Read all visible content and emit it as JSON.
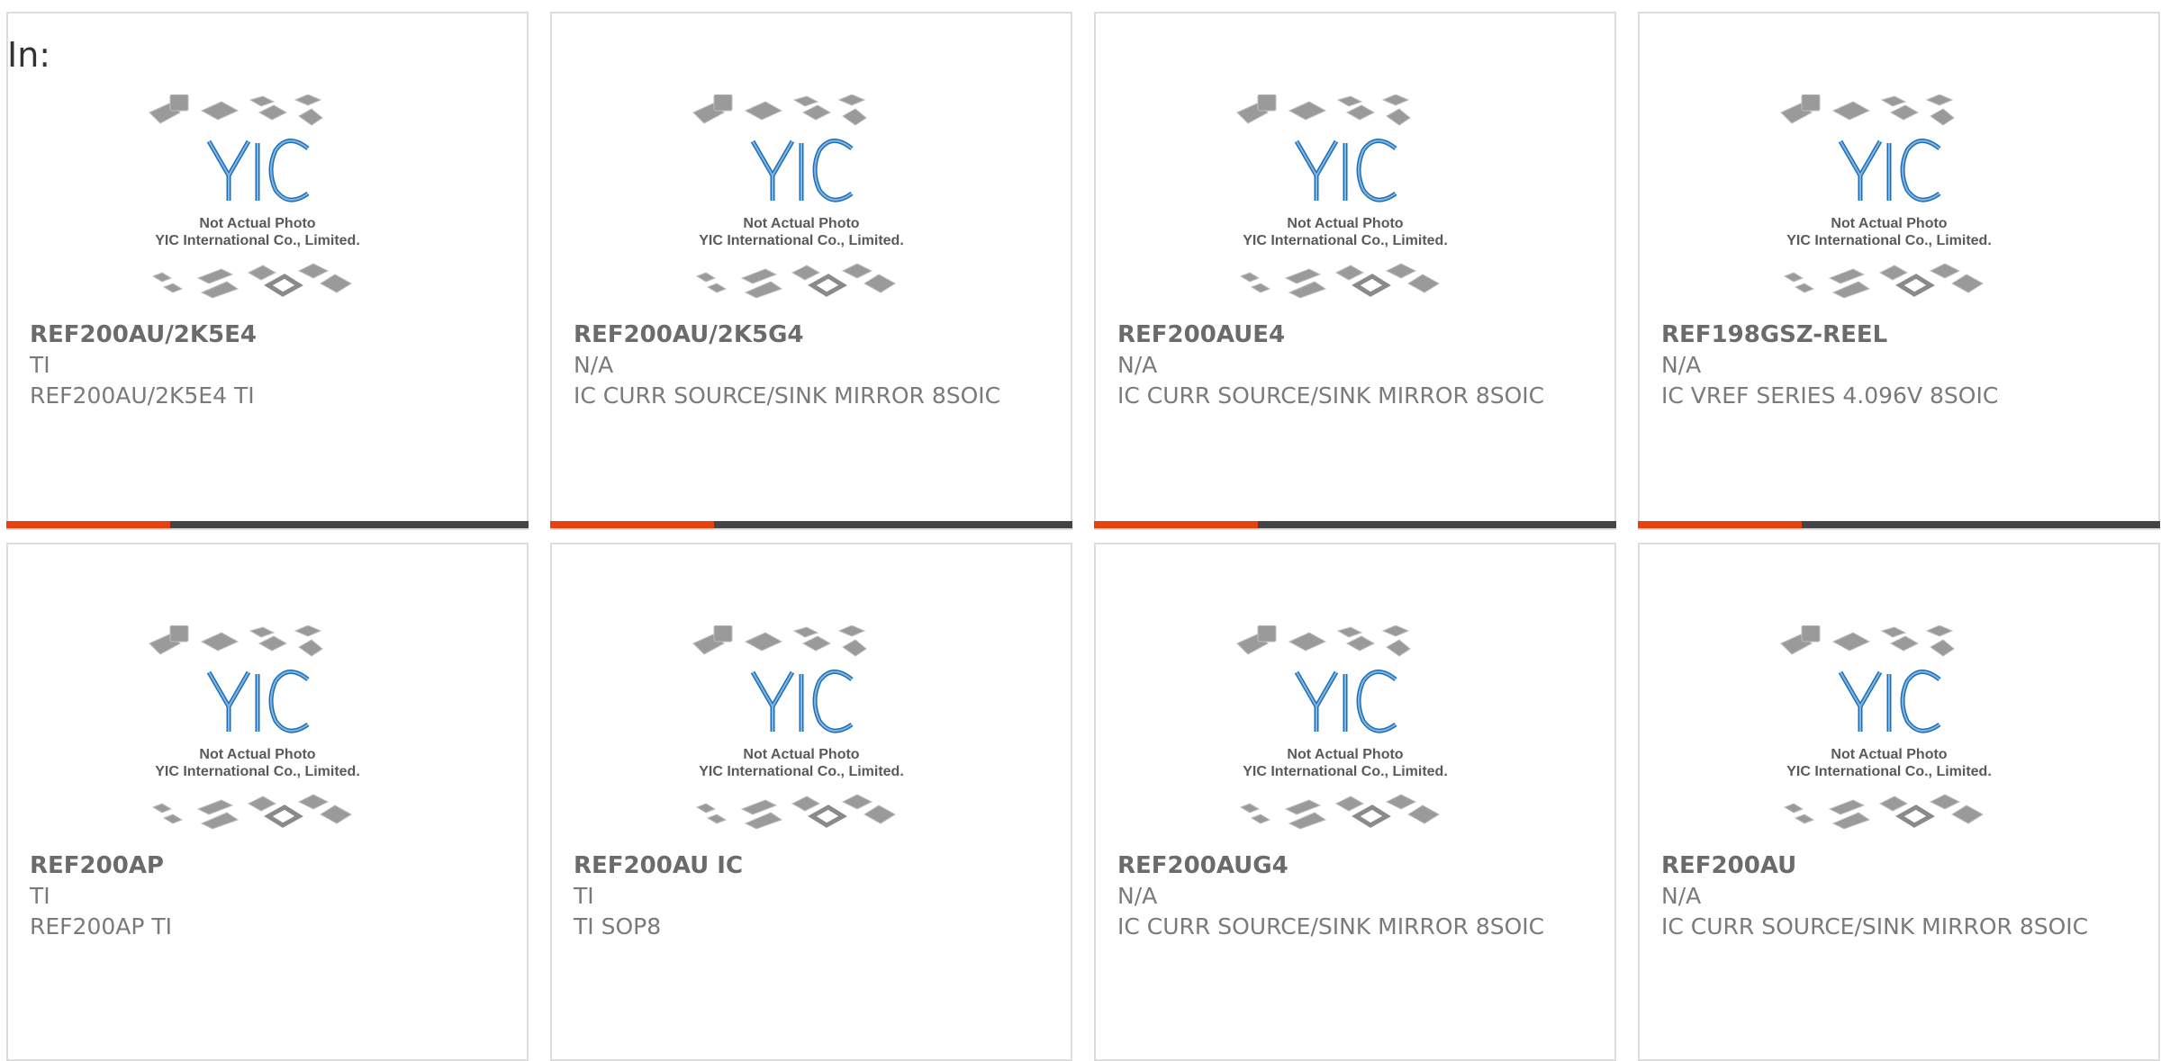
{
  "filter_label": "In:",
  "placeholder_image": {
    "line1": "Not Actual Photo",
    "line2": "YIC International Co., Limited.",
    "logo_text": "YIC"
  },
  "colors": {
    "accent": "#e8410f",
    "bar": "#444444",
    "logo_blue": "#1f6fb5",
    "text": "#6b6b6b"
  },
  "products": [
    {
      "part": "REF200AU/2K5E4",
      "manufacturer": "TI",
      "description": "REF200AU/2K5E4 TI"
    },
    {
      "part": "REF200AU/2K5G4",
      "manufacturer": "N/A",
      "description": "IC CURR SOURCE/SINK MIRROR 8SOIC"
    },
    {
      "part": "REF200AUE4",
      "manufacturer": "N/A",
      "description": "IC CURR SOURCE/SINK MIRROR 8SOIC"
    },
    {
      "part": "REF198GSZ-REEL",
      "manufacturer": "N/A",
      "description": "IC VREF SERIES 4.096V 8SOIC"
    },
    {
      "part": "REF200AP",
      "manufacturer": "TI",
      "description": "REF200AP TI"
    },
    {
      "part": "REF200AU IC",
      "manufacturer": "TI",
      "description": "TI SOP8"
    },
    {
      "part": "REF200AUG4",
      "manufacturer": "N/A",
      "description": "IC CURR SOURCE/SINK MIRROR 8SOIC"
    },
    {
      "part": "REF200AU",
      "manufacturer": "N/A",
      "description": "IC CURR SOURCE/SINK MIRROR 8SOIC"
    }
  ]
}
